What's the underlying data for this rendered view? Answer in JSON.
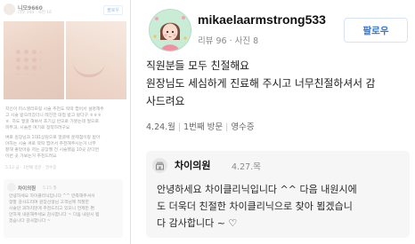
{
  "left_preview": {
    "username": "니모9660",
    "stats": "리뷰 104 · 사진 16",
    "follow_label": "팔로우",
    "review_lines": [
      "지인이 피스넬리프링 시술 추천도 딱딱 찝어서 설명해주",
      "고 시술 받으러갔더니 레진한 대접 받고 왔다구 ㅎㅎㅎ",
      "ㅎ. 하도 얼굴 해봐서 호기심 반으로 가봤는데 얼으로",
      "피부과, 시술은 여기로 정착하려구요"
    ],
    "review_lines_2": [
      "벼로 원장님과 1대1상담으로 얼굴에 문제점이랑 받아",
      "야하는 시술 써로 딱딱 찝어서 추천해주시는거 너무",
      "잘해 좋았어용 저는 공장젤 전 시술했음 10곳 같다면",
      "이번 곳 가보는거 추천드려요"
    ],
    "meta": "5.12.금 · 1번째 방문 · 영수증",
    "reply_name": "차이의원",
    "reply_date": "5.15.월",
    "reply_lines": [
      "안녕하세요 차이클리닉입니다 ^^ 만족해주셔서",
      "정말 감사드리며 원장선생님 고객님께 적절한",
      "시술만 과하지않게 추천드리고 있으니 언제든 편",
      "안하게 내원해주세요 감사합니다 ~ 다음 내원시 뵙",
      "겠습니다 감사합니다 ~"
    ]
  },
  "main": {
    "username": "mikaelaarmstrong533",
    "stats": "리뷰 96 · 사진 8",
    "follow_label": "팔로우",
    "review_lines": [
      "직원분들 모두 친절해요",
      "원장님도 세심하게 진료해 주시고 너무친절하셔서 감",
      "사드려요"
    ],
    "meta": {
      "date": "4.24.월",
      "visit": "1번째 방문",
      "receipt": "영수증"
    },
    "reply": {
      "name": "차이의원",
      "date": "4.27.목",
      "lines": [
        "안녕하세요 차이클리닉입니다 ^^ 다음 내원시에",
        "도 더욱더 친절한 차이클리닉으로 찾아 뵙겠습니",
        "다 감사합니다 ~ ♡"
      ]
    }
  },
  "colors": {
    "follow_text": "#2d74d4",
    "avatar_bg": "#c9ecd6",
    "reply_bg": "#f6f6f6"
  }
}
